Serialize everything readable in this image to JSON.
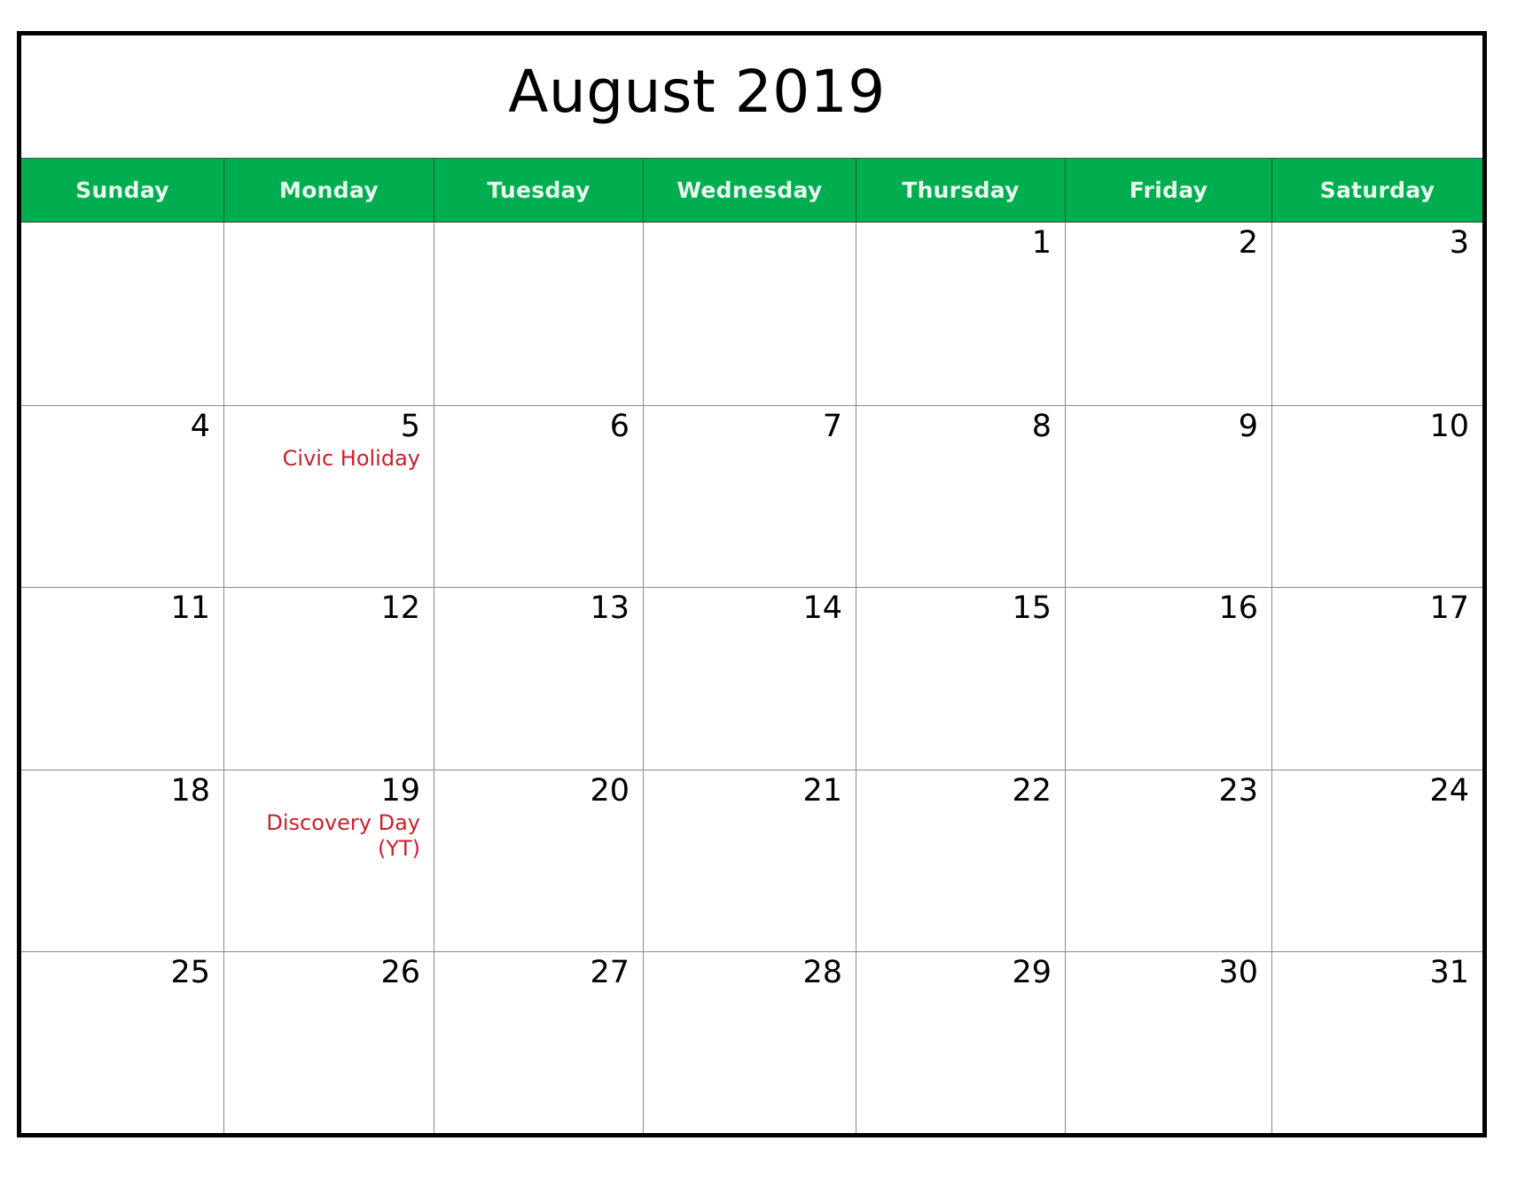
{
  "calendar": {
    "title": "August 2019",
    "colors": {
      "header_bg": "#00ad4f",
      "header_text": "#e9fbef",
      "holiday_text": "#cc1f2a",
      "frame": "#000000",
      "grid_line": "#8a8a8a"
    },
    "weekdays": [
      "Sunday",
      "Monday",
      "Tuesday",
      "Wednesday",
      "Thursday",
      "Friday",
      "Saturday"
    ],
    "weeks": [
      [
        {
          "day": ""
        },
        {
          "day": ""
        },
        {
          "day": ""
        },
        {
          "day": ""
        },
        {
          "day": "1"
        },
        {
          "day": "2"
        },
        {
          "day": "3"
        }
      ],
      [
        {
          "day": "4"
        },
        {
          "day": "5",
          "holiday": "Civic Holiday"
        },
        {
          "day": "6"
        },
        {
          "day": "7"
        },
        {
          "day": "8"
        },
        {
          "day": "9"
        },
        {
          "day": "10"
        }
      ],
      [
        {
          "day": "11"
        },
        {
          "day": "12"
        },
        {
          "day": "13"
        },
        {
          "day": "14"
        },
        {
          "day": "15"
        },
        {
          "day": "16"
        },
        {
          "day": "17"
        }
      ],
      [
        {
          "day": "18"
        },
        {
          "day": "19",
          "holiday": "Discovery Day (YT)"
        },
        {
          "day": "20"
        },
        {
          "day": "21"
        },
        {
          "day": "22"
        },
        {
          "day": "23"
        },
        {
          "day": "24"
        }
      ],
      [
        {
          "day": "25"
        },
        {
          "day": "26"
        },
        {
          "day": "27"
        },
        {
          "day": "28"
        },
        {
          "day": "29"
        },
        {
          "day": "30"
        },
        {
          "day": "31"
        }
      ]
    ]
  }
}
